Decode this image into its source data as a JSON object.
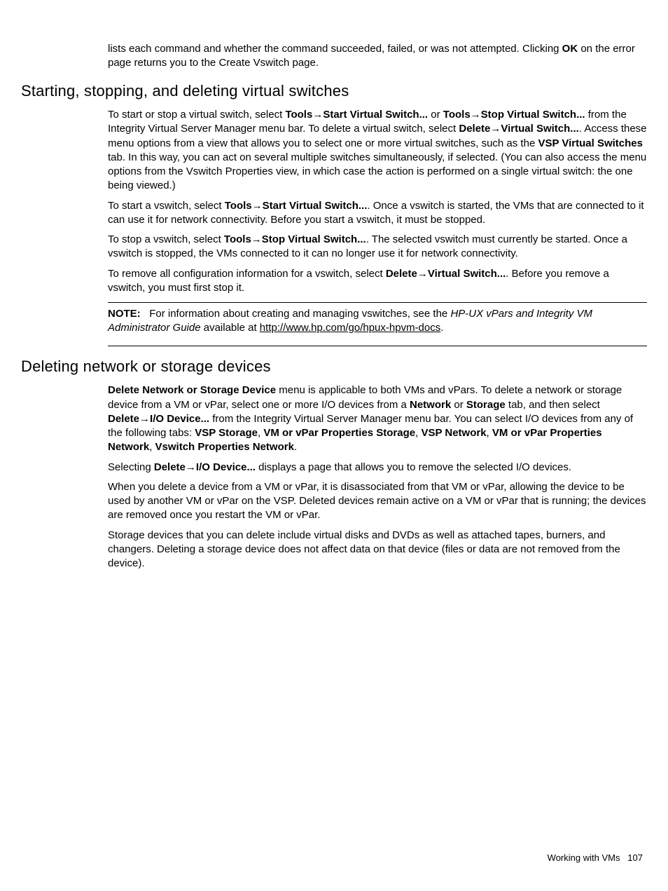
{
  "intro": {
    "p1_a": "lists each command and whether the command succeeded, failed, or was not attempted. Clicking ",
    "p1_b": "OK",
    "p1_c": " on the error page returns you to the Create Vswitch page."
  },
  "sec1": {
    "heading": "Starting, stopping, and deleting virtual switches",
    "p1_a": "To start or stop a virtual switch, select ",
    "p1_b": "Tools",
    "p1_c": "Start Virtual Switch...",
    "p1_d": " or ",
    "p1_e": "Tools",
    "p1_f": "Stop Virtual Switch...",
    "p1_g": " from the Integrity Virtual Server Manager menu bar. To delete a virtual switch, select ",
    "p1_h": "Delete",
    "p1_i": "Virtual Switch...",
    "p1_j": ". Access these menu options from a view that allows you to select one or more virtual switches, such as the ",
    "p1_k": "VSP Virtual Switches",
    "p1_l": " tab. In this way, you can act on several multiple switches simultaneously, if selected. (You can also access the menu options from the Vswitch Properties view, in which case the action is performed on a single virtual switch: the one being viewed.)",
    "p2_a": "To start a vswitch, select ",
    "p2_b": "Tools",
    "p2_c": "Start Virtual Switch...",
    "p2_d": ". Once a vswitch is started, the VMs that are connected to it can use it for network connectivity. Before you start a vswitch, it must be stopped.",
    "p3_a": "To stop a vswitch, select ",
    "p3_b": "Tools",
    "p3_c": "Stop Virtual Switch...",
    "p3_d": ". The selected vswitch must currently be started. Once a vswitch is stopped, the VMs connected to it can no longer use it for network connectivity.",
    "p4_a": "To remove all configuration information for a vswitch, select ",
    "p4_b": "Delete",
    "p4_c": "Virtual Switch...",
    "p4_d": ". Before you remove a vswitch, you must first stop it.",
    "note_label": "NOTE:",
    "note_a": "For information about creating and managing vswitches, see the ",
    "note_b": "HP-UX vPars and Integrity VM Administrator Guide",
    "note_c": " available at ",
    "note_link": "http://www.hp.com/go/hpux-hpvm-docs",
    "note_d": "."
  },
  "sec2": {
    "heading": "Deleting network or storage devices",
    "p1_a": "Delete Network or Storage Device",
    "p1_b": " menu is applicable to both VMs and vPars. To delete a network or storage device from a VM or vPar, select one or more I/O devices from a ",
    "p1_c": "Network",
    "p1_d": " or ",
    "p1_e": "Storage",
    "p1_f": " tab, and then select ",
    "p1_g": "Delete",
    "p1_h": "I/O Device...",
    "p1_i": " from the Integrity Virtual Server Manager menu bar. You can select I/O devices from any of the following tabs: ",
    "p1_j": "VSP Storage",
    "p1_k": ", ",
    "p1_l": "VM or vPar Properties Storage",
    "p1_m": ", ",
    "p1_n": "VSP Network",
    "p1_o": ", ",
    "p1_p": "VM or vPar Properties Network",
    "p1_q": ", ",
    "p1_r": "Vswitch Properties Network",
    "p1_s": ".",
    "p2_a": "Selecting ",
    "p2_b": "Delete",
    "p2_c": "I/O Device...",
    "p2_d": " displays a page that allows you to remove the selected I/O devices.",
    "p3": "When you delete a device from a VM or vPar, it is disassociated from that VM or vPar, allowing the device to be used by another VM or vPar on the VSP. Deleted devices remain active on a VM or vPar that is running; the devices are removed once you restart the VM or vPar.",
    "p4": "Storage devices that you can delete include virtual disks and DVDs as well as attached tapes, burners, and changers. Deleting a storage device does not affect data on that device (files or data are not removed from the device)."
  },
  "footer": {
    "label": "Working with VMs",
    "page": "107"
  },
  "glyph": {
    "arrow": "→"
  }
}
